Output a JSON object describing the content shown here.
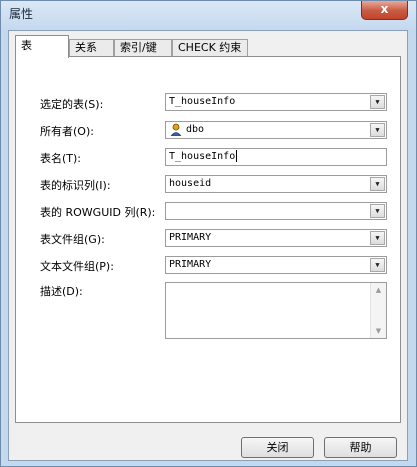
{
  "window": {
    "title": "属性",
    "close_glyph": "x"
  },
  "tabs": [
    {
      "label": "表",
      "active": true
    },
    {
      "label": "关系",
      "active": false
    },
    {
      "label": "索引/键",
      "active": false
    },
    {
      "label": "CHECK 约束",
      "active": false
    }
  ],
  "form": {
    "selected_table": {
      "label": "选定的表(S):",
      "value": "T_houseInfo"
    },
    "owner": {
      "label": "所有者(O):",
      "value": "dbo",
      "icon": "user-icon"
    },
    "table_name": {
      "label": "表名(T):",
      "value": "T_houseInfo"
    },
    "identity_column": {
      "label": "表的标识列(I):",
      "value": "houseid"
    },
    "rowguid_column": {
      "label": "表的 ROWGUID 列(R):",
      "value": ""
    },
    "table_filegroup": {
      "label": "表文件组(G):",
      "value": "PRIMARY"
    },
    "text_filegroup": {
      "label": "文本文件组(P):",
      "value": "PRIMARY"
    },
    "description": {
      "label": "描述(D):",
      "value": ""
    }
  },
  "buttons": {
    "close_label": "关闭",
    "help_label": "帮助"
  },
  "colors": {
    "close_button": "#c75a43",
    "window_frame": "#c4d8ee"
  }
}
